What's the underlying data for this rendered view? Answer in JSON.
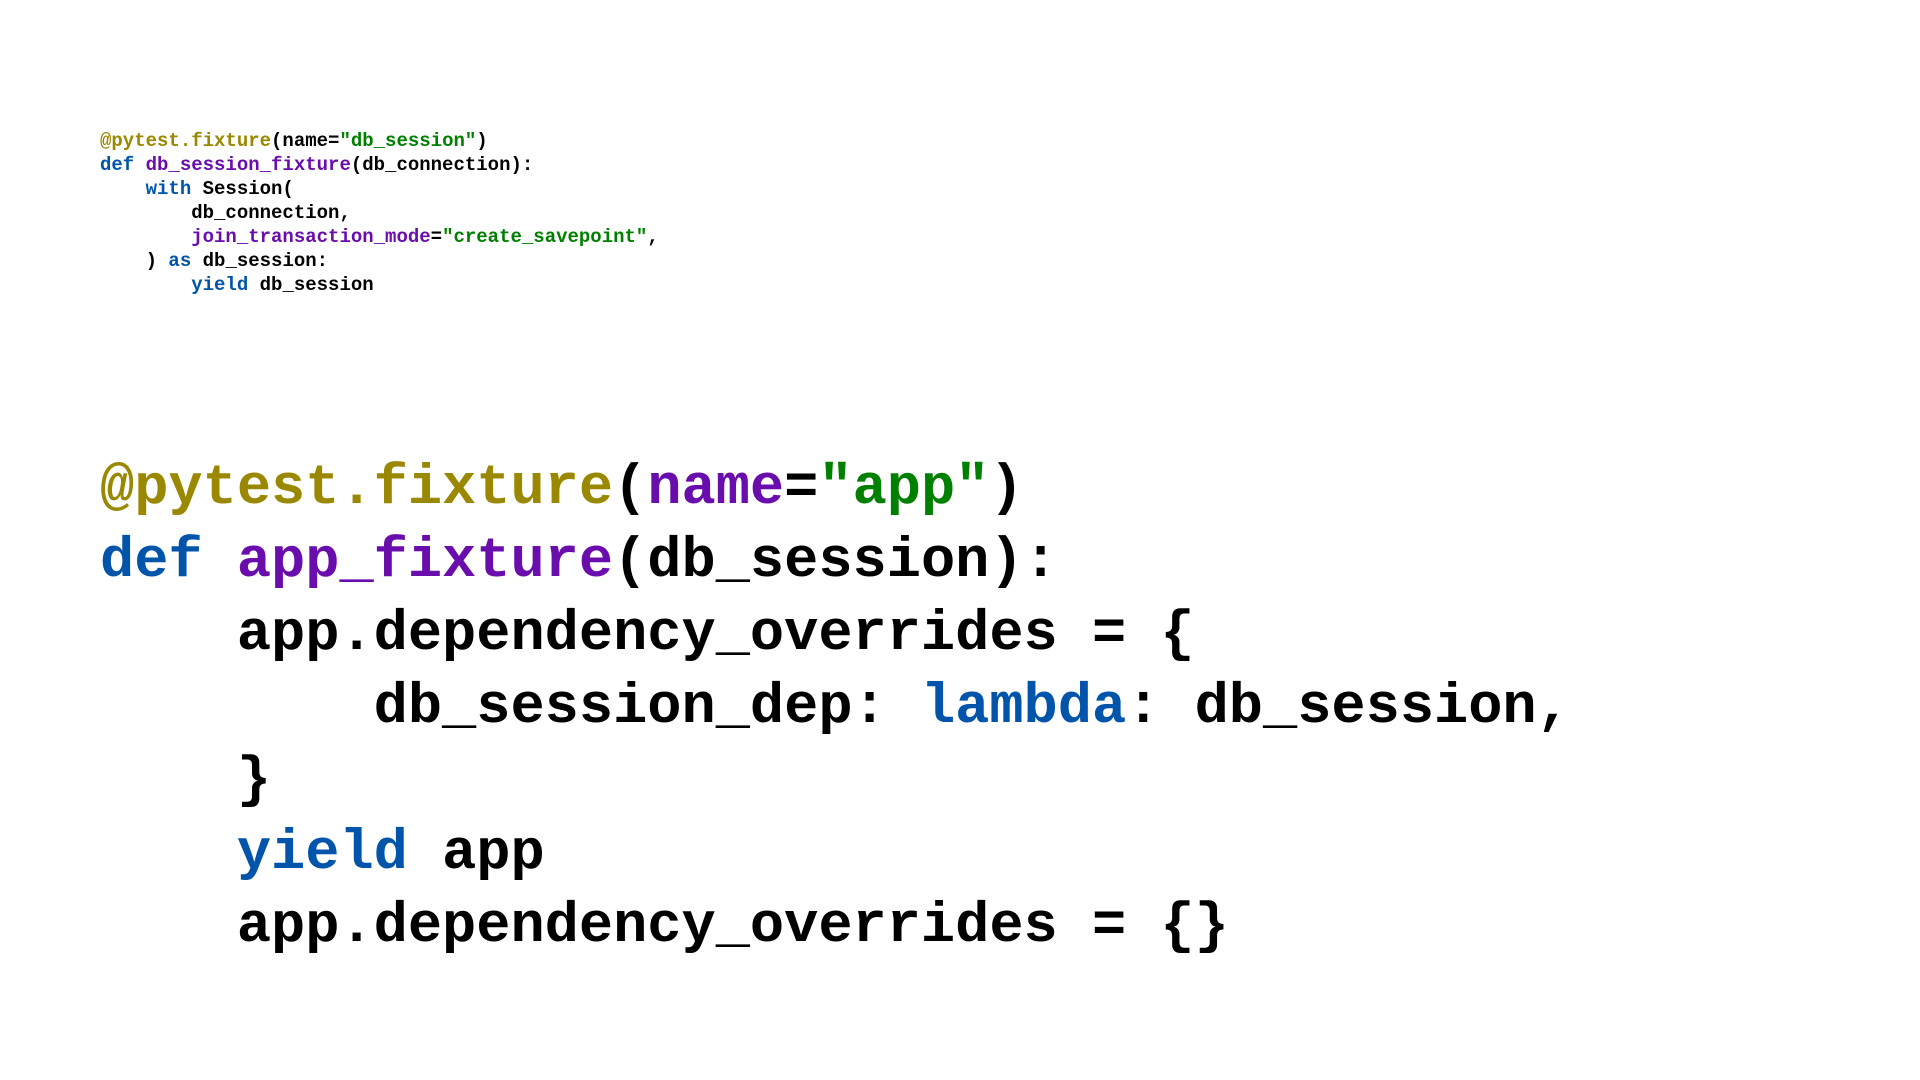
{
  "small": {
    "l1": {
      "a": "@pytest.fixture",
      "b": "(name=",
      "c": "\"db_session\"",
      "d": ")"
    },
    "l2": {
      "a": "def ",
      "b": "db_session_fixture",
      "c": "(db_connection):"
    },
    "l3": {
      "a": "    ",
      "b": "with",
      "c": " Session("
    },
    "l4": {
      "a": "        db_connection,"
    },
    "l5": {
      "a": "        ",
      "b": "join_transaction_mode",
      "c": "=",
      "d": "\"create_savepoint\"",
      "e": ","
    },
    "l6": {
      "a": "    ) ",
      "b": "as",
      "c": " db_session:"
    },
    "l7": {
      "a": "        ",
      "b": "yield",
      "c": " db_session"
    }
  },
  "large": {
    "l1": {
      "a": "@pytest.fixture",
      "b": "(",
      "c": "name",
      "d": "=",
      "e": "\"app\"",
      "f": ")"
    },
    "l2": {
      "a": "def ",
      "b": "app_fixture",
      "c": "(db_session):"
    },
    "l3": {
      "a": "    app.dependency_overrides = {"
    },
    "l4": {
      "a": "        db_session_dep: ",
      "b": "lambda",
      "c": ": db_session,"
    },
    "l5": {
      "a": "    }"
    },
    "l6": {
      "a": "    ",
      "b": "yield",
      "c": " app"
    },
    "l7": {
      "a": "    app.dependency_overrides = {}"
    }
  }
}
